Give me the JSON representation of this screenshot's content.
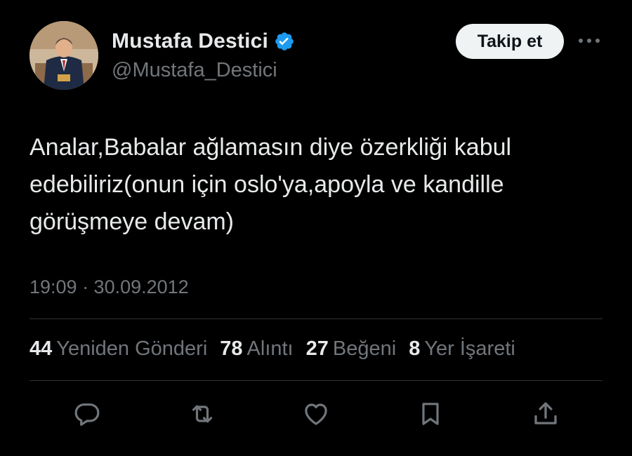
{
  "author": {
    "display_name": "Mustafa Destici",
    "handle": "@Mustafa_Destici",
    "verified": true,
    "avatar_icon": "profile-photo"
  },
  "header": {
    "follow_label": "Takip et",
    "more_icon": "more-horizontal-icon"
  },
  "tweet": {
    "text": "Analar,Babalar ağlamasın diye özerkliği kabul\nedebiliriz(onun için oslo'ya,apoyla ve kandille\ngörüşmeye devam)",
    "timestamp": "19:09 · 30.09.2012"
  },
  "stats": [
    {
      "count": "44",
      "label": "Yeniden Gönderi"
    },
    {
      "count": "78",
      "label": "Alıntı"
    },
    {
      "count": "27",
      "label": "Beğeni"
    },
    {
      "count": "8",
      "label": "Yer İşareti"
    }
  ],
  "actions": {
    "reply_icon": "reply-icon",
    "retweet_icon": "retweet-icon",
    "like_icon": "heart-icon",
    "bookmark_icon": "bookmark-icon",
    "share_icon": "share-icon"
  },
  "colors": {
    "background": "#000000",
    "primary_text": "#e7e9ea",
    "secondary_text": "#71767b",
    "verified_blue": "#1d9bf0",
    "divider": "#2f3336",
    "button_bg": "#eff3f4"
  }
}
